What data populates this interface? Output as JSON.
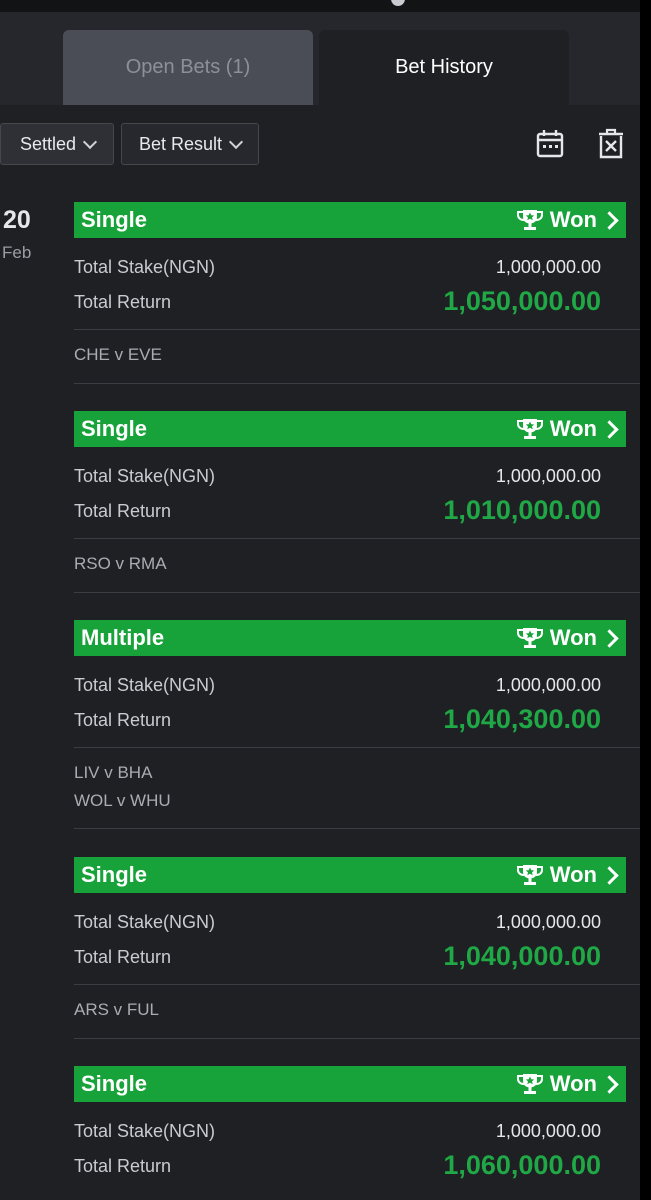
{
  "tabs": {
    "open_bets": "Open Bets (1)",
    "bet_history": "Bet History"
  },
  "filters": {
    "status": "Settled",
    "result": "Bet Result"
  },
  "date": {
    "day": "20",
    "month": "Feb"
  },
  "labels": {
    "total_stake": "Total Stake(NGN)",
    "total_return": "Total Return",
    "won": "Won"
  },
  "colors": {
    "won_green": "#17a23a",
    "return_green": "#1fa845",
    "background": "#1e2024"
  },
  "icons": [
    "calendar-icon",
    "delete-icon",
    "trophy-icon",
    "chevron-right-icon",
    "chevron-down-icon"
  ],
  "bets": [
    {
      "type": "Single",
      "status": "Won",
      "stake": "1,000,000.00",
      "return": "1,050,000.00",
      "matches": [
        "CHE v EVE"
      ]
    },
    {
      "type": "Single",
      "status": "Won",
      "stake": "1,000,000.00",
      "return": "1,010,000.00",
      "matches": [
        "RSO v RMA"
      ]
    },
    {
      "type": "Multiple",
      "status": "Won",
      "stake": "1,000,000.00",
      "return": "1,040,300.00",
      "matches": [
        "LIV v BHA",
        "WOL v WHU"
      ]
    },
    {
      "type": "Single",
      "status": "Won",
      "stake": "1,000,000.00",
      "return": "1,040,000.00",
      "matches": [
        "ARS v FUL"
      ]
    },
    {
      "type": "Single",
      "status": "Won",
      "stake": "1,000,000.00",
      "return": "1,060,000.00",
      "matches": []
    }
  ]
}
